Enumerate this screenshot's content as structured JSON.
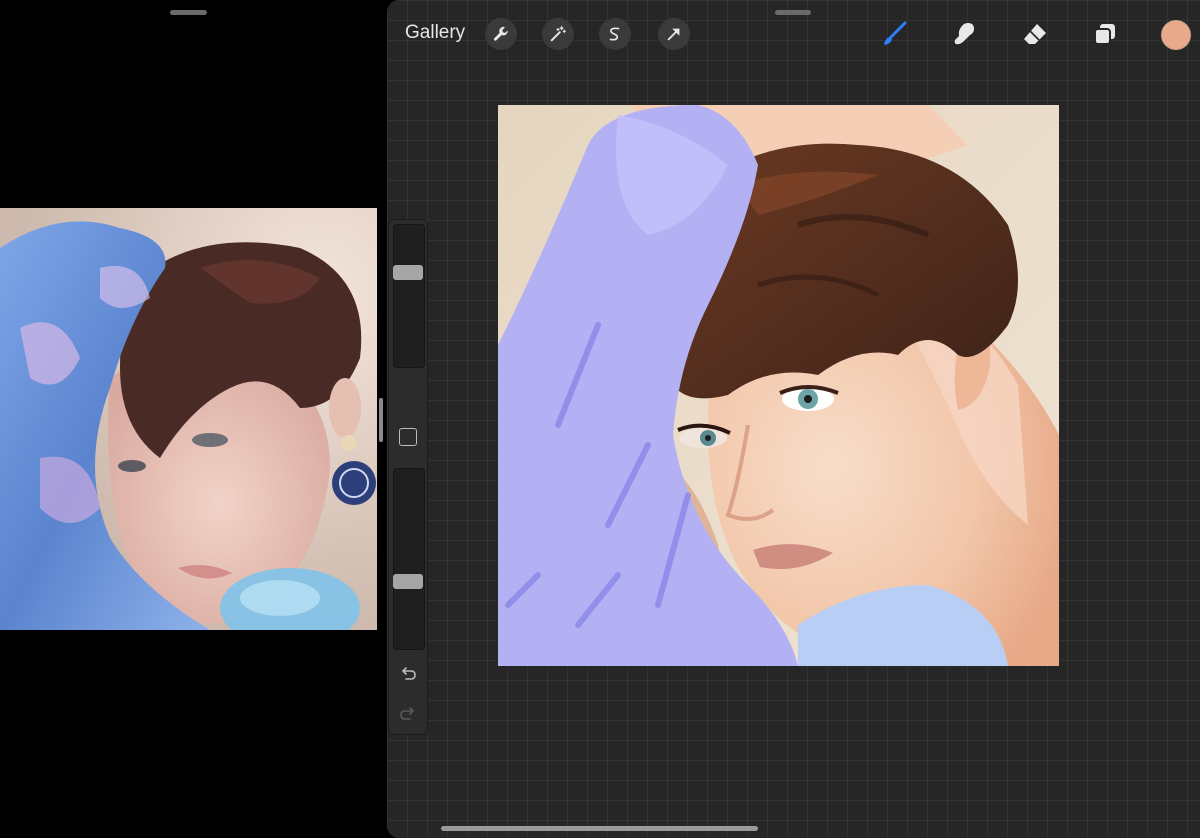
{
  "toolbar": {
    "gallery_label": "Gallery",
    "left_tools": [
      "wrench-icon",
      "magic-wand-icon",
      "selection-icon",
      "transform-arrow-icon"
    ],
    "right_tools": [
      "brush-icon",
      "smudge-icon",
      "eraser-icon",
      "layers-icon"
    ],
    "active_tool": "brush-icon",
    "active_color": "#e9a98b",
    "accent_color": "#2e7dfb"
  },
  "sidebar": {
    "brush_size_percent": 68,
    "opacity_percent": 36,
    "icons": [
      "modify-square-icon",
      "undo-icon",
      "redo-icon"
    ]
  }
}
